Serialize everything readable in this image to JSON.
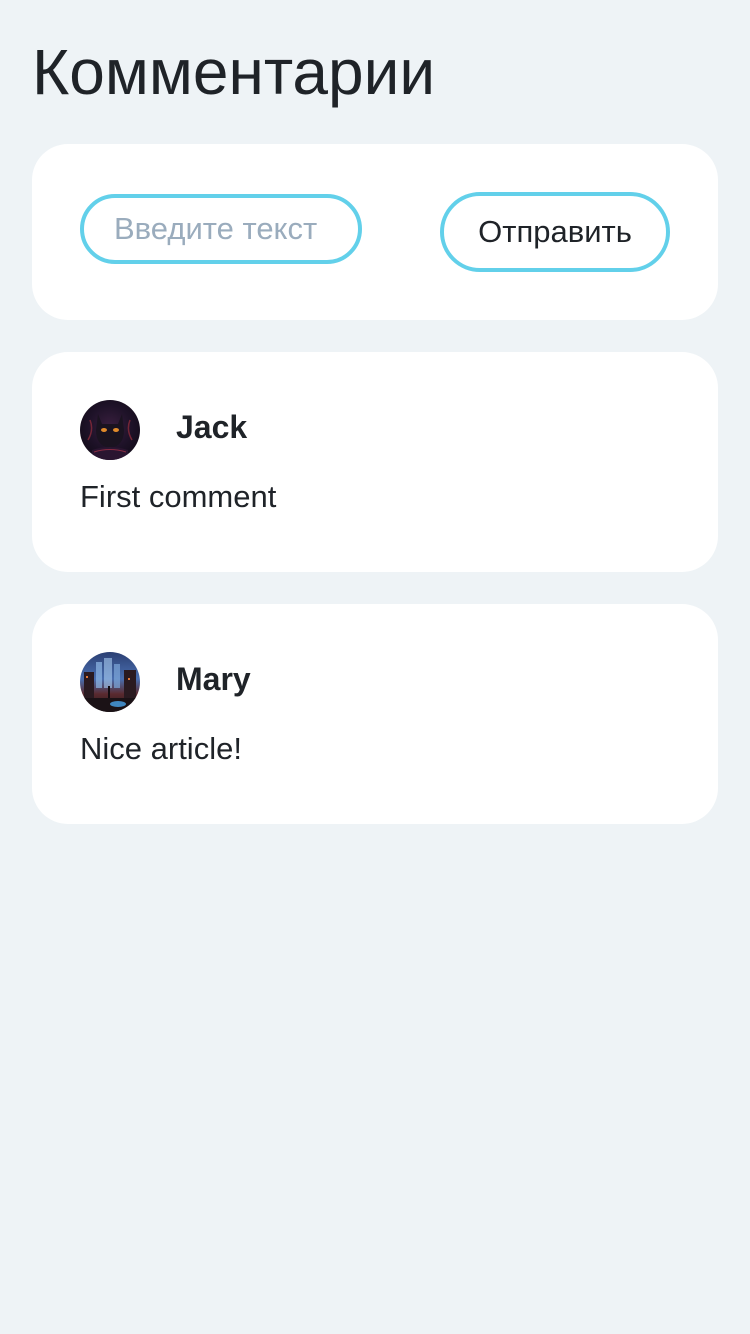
{
  "page": {
    "title": "Комментарии"
  },
  "composer": {
    "input_placeholder": "Введите текст",
    "input_value": "",
    "send_label": "Отправить"
  },
  "comments": [
    {
      "author": "Jack",
      "text": "First comment",
      "avatar_icon": "cat-avatar-icon"
    },
    {
      "author": "Mary",
      "text": "Nice article!",
      "avatar_icon": "city-avatar-icon"
    }
  ],
  "colors": {
    "background": "#eef3f6",
    "card": "#ffffff",
    "accent_border": "#62d0ea",
    "text": "#1f2328",
    "placeholder": "#9aacbd"
  }
}
